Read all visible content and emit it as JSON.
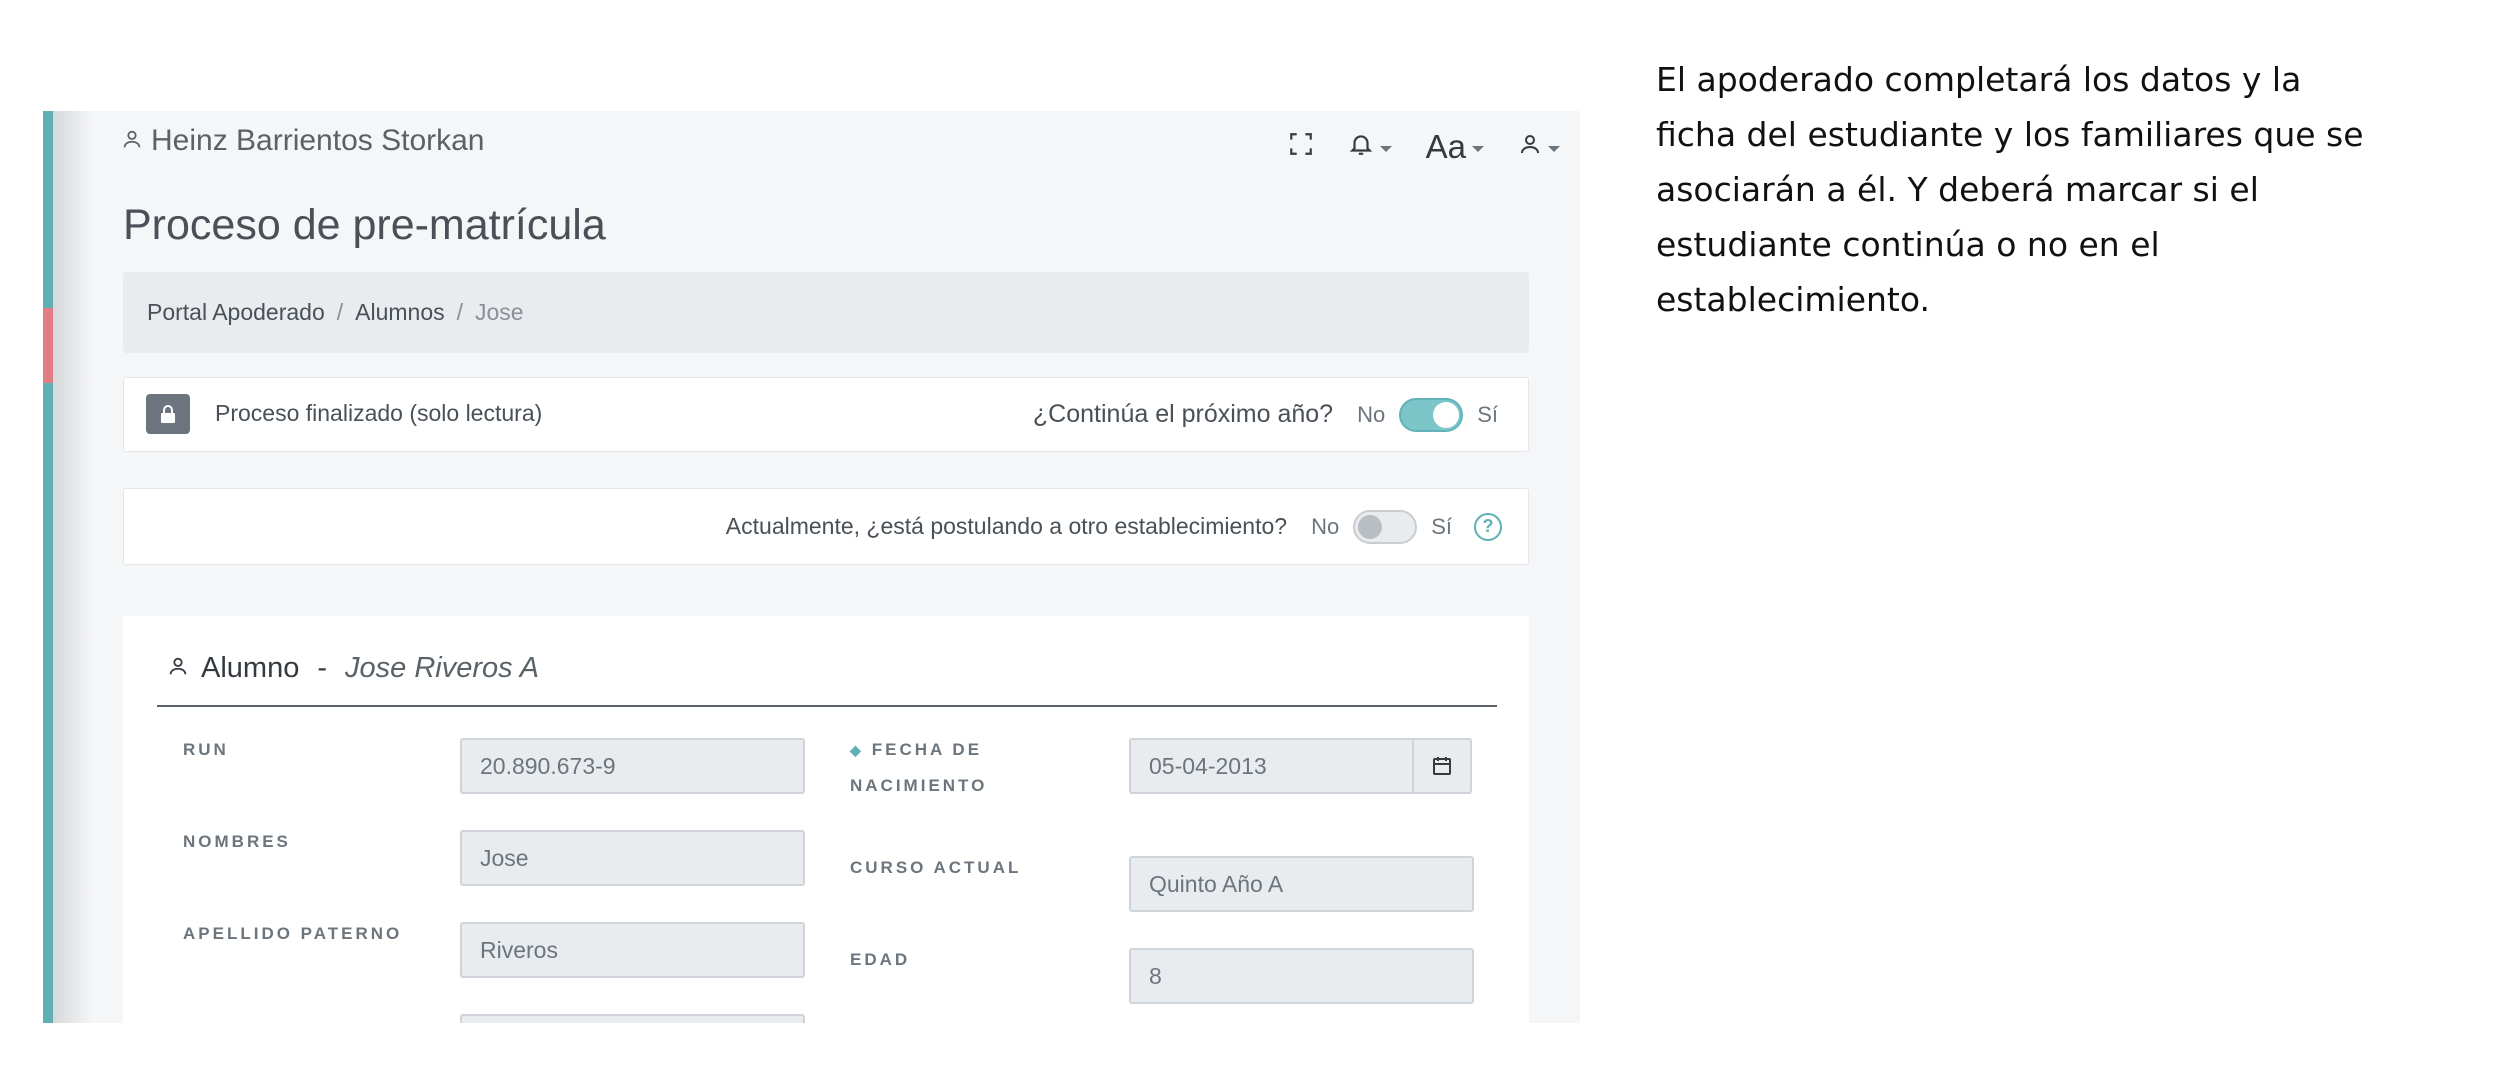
{
  "header": {
    "user_name": "Heinz Barrientos Storkan",
    "font_menu_label": "Aa",
    "icons": [
      "user-icon",
      "fullscreen-icon",
      "bell-icon",
      "font-size-icon",
      "user-menu-icon"
    ]
  },
  "page": {
    "title": "Proceso de pre-matrícula"
  },
  "breadcrumb": {
    "items": [
      "Portal Apoderado",
      "Alumnos",
      "Jose"
    ],
    "separator": "/"
  },
  "status_card": {
    "text": "Proceso finalizado (solo lectura)",
    "question": "¿Continúa el próximo año?",
    "no": "No",
    "yes": "Sí",
    "toggle_on": true
  },
  "apply_card": {
    "question": "Actualmente, ¿está postulando a otro establecimiento?",
    "no": "No",
    "yes": "Sí",
    "toggle_on": false
  },
  "student_section": {
    "title": "Alumno",
    "separator": "-",
    "name": "Jose Riveros A",
    "fields": {
      "run_label": "RUN",
      "run_value": "20.890.673-9",
      "nombres_label": "NOMBRES",
      "nombres_value": "Jose",
      "apellido_label": "APELLIDO PATERNO",
      "apellido_value": "Riveros",
      "fecha_label_1": "FECHA DE",
      "fecha_label_2": "NACIMIENTO",
      "fecha_value": "05-04-2013",
      "curso_label": "CURSO ACTUAL",
      "curso_value": "Quinto Año A",
      "edad_label": "EDAD",
      "edad_value": "8"
    }
  },
  "description": "El apoderado completará los datos y la ficha del estudiante y los familiares que se asociarán a él. Y deberá marcar si el estudiante continúa o no en el establecimiento.",
  "colors": {
    "accent": "#5fb0b4",
    "toggle_on": "#7cc5c8",
    "sidebar_alert": "#e27d86"
  }
}
